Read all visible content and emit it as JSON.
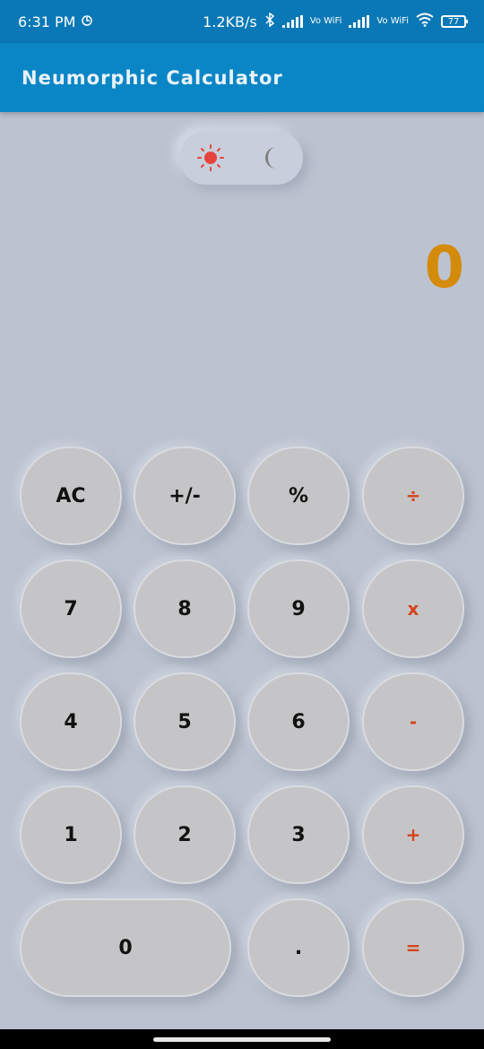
{
  "status_bar": {
    "time": "6:31 PM",
    "net_speed": "1.2KB/s",
    "vo_wifi_label_1": "Vo WiFi",
    "vo_wifi_label_2": "Vo WiFi",
    "battery": "77"
  },
  "app_bar": {
    "title": "Neumorphic Calculator"
  },
  "theme_toggle": {
    "light_icon": "sun-icon",
    "dark_icon": "moon-icon",
    "selected": "light"
  },
  "display": {
    "value": "0"
  },
  "keys": {
    "ac": "AC",
    "plus_minus": "+/-",
    "percent": "%",
    "divide": "÷",
    "seven": "7",
    "eight": "8",
    "nine": "9",
    "multiply": "x",
    "four": "4",
    "five": "5",
    "six": "6",
    "minus": "-",
    "one": "1",
    "two": "2",
    "three": "3",
    "plus": "+",
    "zero": "0",
    "dot": ".",
    "equals": "="
  },
  "colors": {
    "app_bar": "#0a86c6",
    "background": "#bcc3d0",
    "display_text": "#d48a0b",
    "operator_text": "#d4441b",
    "sun": "#e5443c"
  }
}
